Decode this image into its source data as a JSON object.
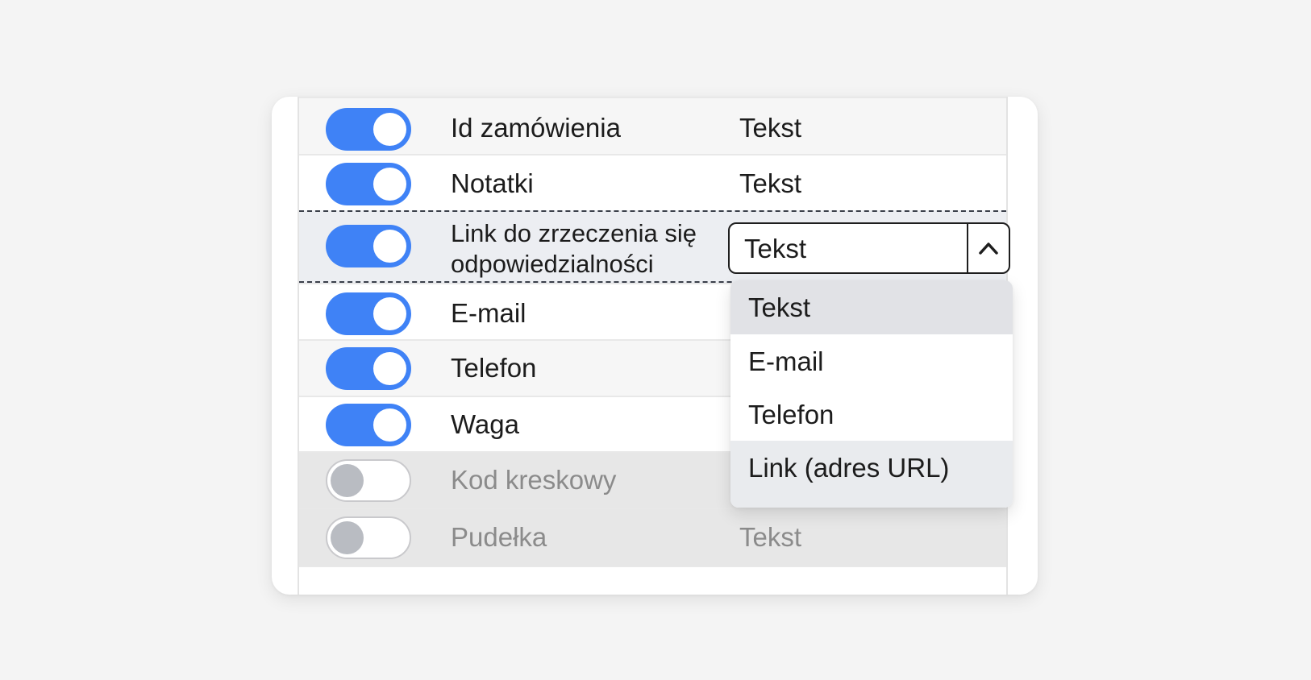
{
  "rows": [
    {
      "name": "Id zamówienia",
      "type": "Tekst",
      "enabled": true
    },
    {
      "name": "Notatki",
      "type": "Tekst",
      "enabled": true
    },
    {
      "name_line1": "Link do zrzeczenia się",
      "name_line2": "odpowiedzialności",
      "type": "Tekst",
      "enabled": true
    },
    {
      "name": "E-mail",
      "enabled": true
    },
    {
      "name": "Telefon",
      "enabled": true
    },
    {
      "name": "Waga",
      "enabled": true
    },
    {
      "name": "Kod kreskowy",
      "enabled": false
    },
    {
      "name": "Pudełka",
      "type": "Tekst",
      "enabled": false
    }
  ],
  "dropdown": {
    "selected": "Tekst",
    "options": [
      "Tekst",
      "E-mail",
      "Telefon",
      "Link (adres URL)"
    ]
  },
  "icons": {
    "expand": "chevron-up-icon"
  },
  "colors": {
    "toggle_on": "#3f82f6",
    "toggle_off_knob": "#b9bcc2"
  }
}
